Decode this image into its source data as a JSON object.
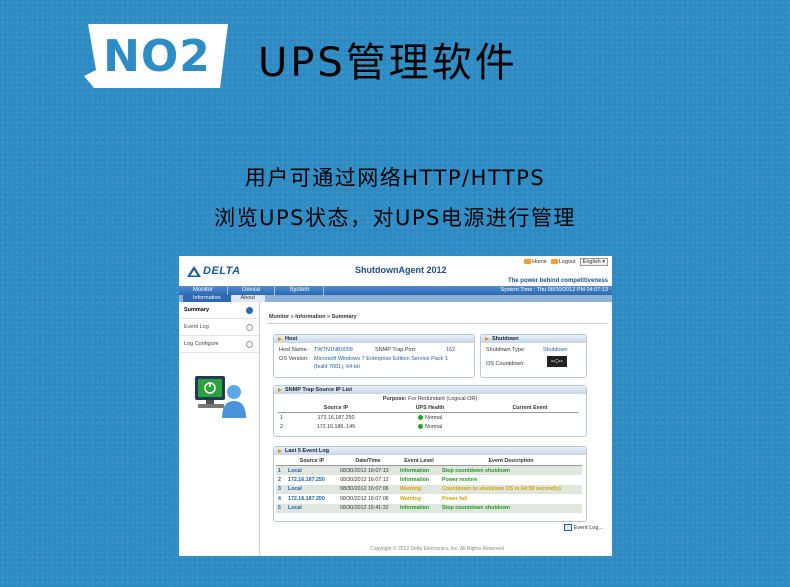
{
  "banner": {
    "badge": "NO2",
    "title": "UPS管理软件",
    "subtitle_line1": "用户可通过网络HTTP/HTTPS",
    "subtitle_line2": "浏览UPS状态，对UPS电源进行管理"
  },
  "app": {
    "logo": "DELTA",
    "product": "ShutdownAgent 2012",
    "links": {
      "home": "Home",
      "logout": "Logout",
      "language": "English"
    },
    "tagline": "The power behind competitiveness",
    "nav": [
      "Monitor",
      "Device",
      "System"
    ],
    "system_time": "System Time : Thu 08/30/2012 PM 04:07:13",
    "tabs": [
      "Information",
      "About"
    ],
    "sidebar": [
      "Summary",
      "Event Log",
      "Log Configure"
    ],
    "breadcrumb": "Monitor » Information » Summary",
    "host": {
      "title": "Host",
      "host_name_label": "Host Name:",
      "host_name": "TWTN1NB0058",
      "snmp_port_label": "SNMP Trap Port:",
      "snmp_port": "162",
      "os_label": "OS Version:",
      "os_line1": "Microsoft Windows 7 Enterprise Edition Service Pack 1",
      "os_line2": "(build 7601), 64-bit"
    },
    "shutdown": {
      "title": "Shutdown",
      "type_label": "Shutdown Type:",
      "type": "Shutdown",
      "countdown_label": "OS Countdown:",
      "countdown": "--:--"
    },
    "snmp_list": {
      "title": "SNMP Trap Source IP List",
      "purpose_label": "Purpose:",
      "purpose": "For Redundant (Logical OR)",
      "headers": [
        "",
        "Source IP",
        "UPS Health",
        "Current Event"
      ],
      "rows": [
        {
          "n": "1",
          "ip": "172.16.187.250",
          "health": "Normal",
          "event": ""
        },
        {
          "n": "2",
          "ip": "172.16.186..145",
          "health": "Normal",
          "event": ""
        }
      ]
    },
    "events": {
      "title": "Last 5 Event Log",
      "headers": [
        "",
        "Source IP",
        "Date/Time",
        "Event Level",
        "Event Description"
      ],
      "rows": [
        {
          "n": "1",
          "ip": "Local",
          "time": "08/30/2012 16:07:13",
          "level": "Information",
          "desc": "Stop countdown shutdown"
        },
        {
          "n": "2",
          "ip": "172.16.187.250",
          "time": "08/30/2012 16:07:12",
          "level": "Information",
          "desc": "Power restore"
        },
        {
          "n": "3",
          "ip": "Local",
          "time": "08/30/2012 16:07:06",
          "level": "Warning",
          "desc": "Countdown to shutdown OS in 04:59 second(s)"
        },
        {
          "n": "4",
          "ip": "172.16.187.250",
          "time": "08/30/2012 16:07:06",
          "level": "Warning",
          "desc": "Power fail"
        },
        {
          "n": "5",
          "ip": "Local",
          "time": "08/30/2012 15:41:32",
          "level": "Information",
          "desc": "Stop countdown shutdown"
        }
      ],
      "more": "Event Log..."
    },
    "footer": "Copyright © 2012 Delta Electronics, Inc. All Rights Reserved"
  },
  "colors": {
    "background": "#2e8cc4",
    "nav": "#2d69b0",
    "info": "#1a9a1a",
    "warning": "#d6a200"
  }
}
